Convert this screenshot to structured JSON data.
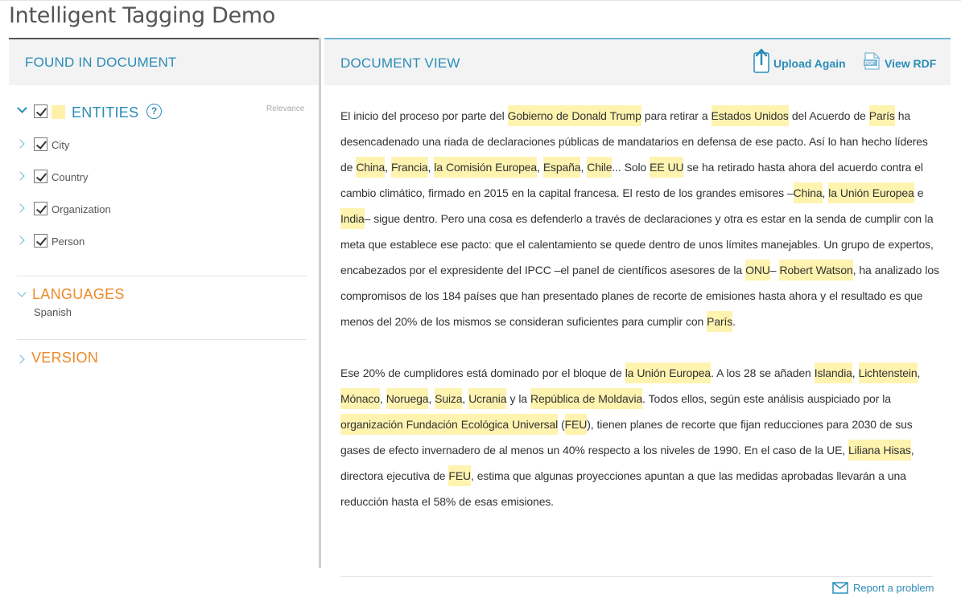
{
  "app": {
    "title": "Intelligent Tagging Demo"
  },
  "left": {
    "header": "FOUND IN DOCUMENT",
    "entities": {
      "label": "ENTITIES",
      "help": "?",
      "relevance": "Relevance",
      "items": [
        {
          "label": "City"
        },
        {
          "label": "Country"
        },
        {
          "label": "Organization"
        },
        {
          "label": "Person"
        }
      ]
    },
    "languages": {
      "label": "LANGUAGES",
      "value": "Spanish"
    },
    "version": {
      "label": "VERSION"
    }
  },
  "right": {
    "header": "DOCUMENT VIEW",
    "upload_label": "Upload Again",
    "view_rdf_label": "View RDF",
    "paragraphs": [
      [
        {
          "t": "El inicio del proceso por parte del "
        },
        {
          "t": "Gobierno de Donald Trump",
          "h": true
        },
        {
          "t": " para retirar a "
        },
        {
          "t": "Estados Unidos",
          "h": true
        },
        {
          "t": " del Acuerdo de "
        },
        {
          "t": "París",
          "h": true
        },
        {
          "t": " ha desencadenado una riada de declaraciones públicas de mandatarios en defensa de ese pacto. Así lo han hecho líderes de "
        },
        {
          "t": "China",
          "h": true
        },
        {
          "t": ", "
        },
        {
          "t": "Francia",
          "h": true
        },
        {
          "t": ", "
        },
        {
          "t": "la Comisión Europea",
          "h": true
        },
        {
          "t": ", "
        },
        {
          "t": "España",
          "h": true
        },
        {
          "t": ", "
        },
        {
          "t": "Chile",
          "h": true
        },
        {
          "t": "... Solo "
        },
        {
          "t": "EE UU",
          "h": true
        },
        {
          "t": " se ha retirado hasta ahora del acuerdo contra el cambio climático, firmado en 2015 en la capital francesa. El resto de los grandes emisores –"
        },
        {
          "t": "China",
          "h": true
        },
        {
          "t": ", "
        },
        {
          "t": "la Unión Europea",
          "h": true
        },
        {
          "t": " e "
        },
        {
          "t": "India",
          "h": true
        },
        {
          "t": "– sigue dentro. Pero una cosa es defenderlo a través de declaraciones y otra es estar en la senda de cumplir con la meta que establece ese pacto: que el calentamiento se quede dentro de unos límites manejables. Un grupo de expertos, encabezados por el expresidente del IPCC –el panel de científicos asesores de la "
        },
        {
          "t": "ONU",
          "h": true
        },
        {
          "t": "– "
        },
        {
          "t": "Robert Watson",
          "h": true
        },
        {
          "t": ", ha analizado los compromisos de los 184 países que han presentado planes de recorte de emisiones hasta ahora y el resultado es que menos del 20% de los mismos se consideran suficientes para cumplir con "
        },
        {
          "t": "París",
          "h": true
        },
        {
          "t": "."
        }
      ],
      [
        {
          "t": "Ese 20% de cumplidores está dominado por el bloque de "
        },
        {
          "t": "la Unión Europea",
          "h": true
        },
        {
          "t": ". A los 28 se añaden "
        },
        {
          "t": "Islandia",
          "h": true
        },
        {
          "t": ", "
        },
        {
          "t": "Lichtenstein",
          "h": true
        },
        {
          "t": ", "
        },
        {
          "t": "Mónaco",
          "h": true
        },
        {
          "t": ", "
        },
        {
          "t": "Noruega",
          "h": true
        },
        {
          "t": ", "
        },
        {
          "t": "Suiza",
          "h": true
        },
        {
          "t": ", "
        },
        {
          "t": "Ucrania",
          "h": true
        },
        {
          "t": " y la "
        },
        {
          "t": "República de Moldavia",
          "h": true
        },
        {
          "t": ". Todos ellos, según este análisis auspiciado por la "
        },
        {
          "t": "organización Fundación Ecológica Universal",
          "h": true
        },
        {
          "t": " ("
        },
        {
          "t": "FEU",
          "h": true
        },
        {
          "t": "), tienen planes de recorte que fijan reducciones para 2030 de sus gases de efecto invernadero de al menos un 40% respecto a los niveles de 1990. En el caso de la UE, "
        },
        {
          "t": "Liliana Hisas",
          "h": true
        },
        {
          "t": ", directora ejecutiva de "
        },
        {
          "t": "FEU",
          "h": true
        },
        {
          "t": ", estima que algunas proyecciones apuntan a que las medidas aprobadas llevarán a una reducción hasta el 58% de esas emisiones."
        }
      ]
    ],
    "report_label": "Report a problem"
  },
  "colors": {
    "accent": "#2a8db8",
    "section_orange": "#ee8a2a",
    "highlight": "#fff3b0"
  }
}
